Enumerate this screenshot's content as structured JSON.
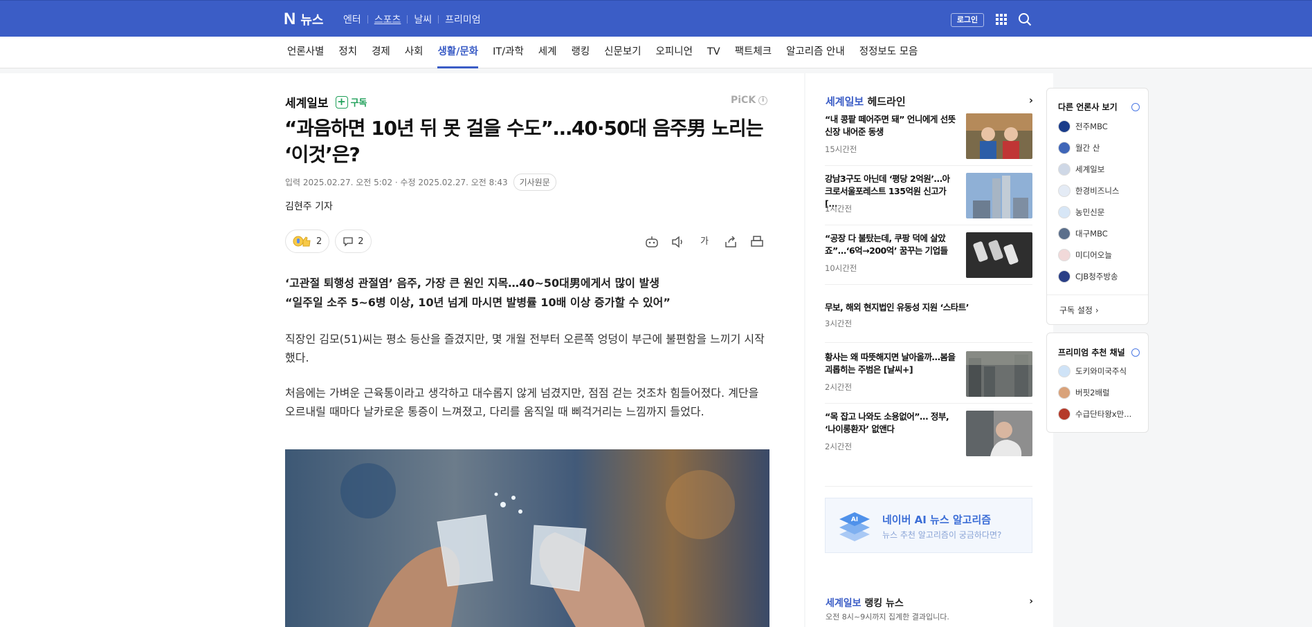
{
  "header": {
    "brand_n": "N",
    "brand_text": "뉴스",
    "services": [
      "엔터",
      "스포츠",
      "날씨",
      "프리미엄"
    ],
    "login": "로그인"
  },
  "nav": [
    "언론사별",
    "정치",
    "경제",
    "사회",
    "생활/문화",
    "IT/과학",
    "세계",
    "랭킹",
    "신문보기",
    "오피니언",
    "TV",
    "팩트체크",
    "알고리즘 안내",
    "정정보도 모음"
  ],
  "nav_active": "생활/문화",
  "article": {
    "press": "세계일보",
    "subscribe": "구독",
    "pick": "PiCK",
    "title_line1": "“과음하면 10년 뒤 못 걸을 수도”…40·50대 음주男 노리는",
    "title_line2": "‘이것’은?",
    "dates": "입력 2025.02.27. 오전 5:02 · 수정 2025.02.27. 오전 8:43",
    "original": "기사원문",
    "reporter": "김현주 기자",
    "reaction_count": "2",
    "comment_count": "2",
    "text_size": "가",
    "summary_line1": "‘고관절 퇴행성 관절염’ 음주, 가장 큰 원인 지목…40~50대男에게서 많이 발생",
    "summary_line2": "“일주일 소주 5~6병 이상, 10년 넘게 마시면 발병률 10배 이상 증가할 수 있어”",
    "para1": "직장인 김모(51)씨는 평소 등산을 즐겼지만, 몇 개월 전부터 오른쪽 엉덩이 부근에 불편함을 느끼기 시작했다.",
    "para2": "처음에는 가벼운 근육통이라고 생각하고 대수롭지 않게 넘겼지만, 점점 걷는 것조차 힘들어졌다. 계단을 오르내릴 때마다 날카로운 통증이 느껴졌고, 다리를 움직일 때 삐걱거리는 느낌까지 들었다."
  },
  "headlines": {
    "press": "세계일보",
    "label": "헤드라인",
    "items": [
      {
        "title": "“내 콩팥 떼어주면 돼” 언니에게 선뜻 신장 내어준 동생",
        "time": "15시간전"
      },
      {
        "title": "강남3구도 아닌데 ‘평당 2억원’…아크로서울포레스트 135억원 신고가 [...",
        "time": "1시간전"
      },
      {
        "title": "“공장 다 불탔는데, 쿠팡 덕에 살았죠”…‘6억→200억’ 꿈꾸는 기업들",
        "time": "10시간전"
      },
      {
        "title": "무보, 해외 현지법인 유동성 지원 ‘스타트’",
        "time": "3시간전"
      },
      {
        "title": "황사는 왜 따뜻해지면 날아올까…봄을 괴롭히는 주범은 [날씨+]",
        "time": "2시간전"
      },
      {
        "title": "“목 잡고 나와도 소용없어”… 정부, ‘나이롱환자’ 없앤다",
        "time": "2시간전"
      }
    ]
  },
  "ai": {
    "title": "네이버 AI 뉴스 알고리즘",
    "desc": "뉴스 추천 알고리즘이 궁금하다면?",
    "icon_text": "AI"
  },
  "ranking": {
    "press": "세계일보",
    "label": "랭킹 뉴스",
    "sub": "오전 8시~9시까지 집계한 결과입니다."
  },
  "other_press": {
    "title": "다른 언론사 보기",
    "items": [
      "전주MBC",
      "월간 산",
      "세계일보",
      "한경비즈니스",
      "농민신문",
      "대구MBC",
      "미디어오늘",
      "CJB청주방송"
    ],
    "settings": "구독 설정"
  },
  "premium": {
    "title": "프리미엄 추천 채널",
    "items": [
      "도키와미국주식",
      "버핏2배럴",
      "수급단타왕x만..."
    ]
  },
  "colors": {
    "brand": "#3b5dc6",
    "subscribe_green": "#20a05a"
  }
}
